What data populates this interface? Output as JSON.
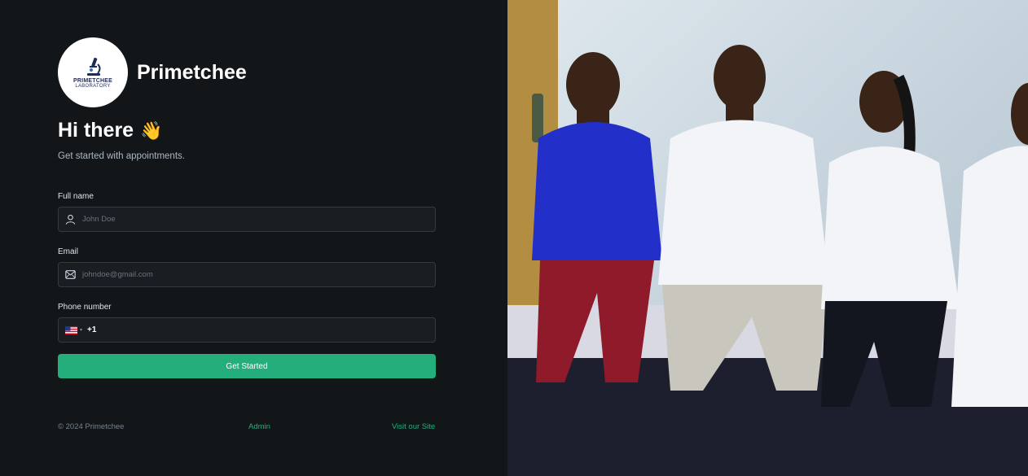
{
  "brand": {
    "name": "Primetchee",
    "logo_title": "PRIMETCHEE",
    "logo_subtitle": "LABORATORY",
    "icon": "microscope-icon"
  },
  "hero": {
    "greeting": "Hi there",
    "wave": "👋",
    "subtitle": "Get started with appointments."
  },
  "form": {
    "full_name": {
      "label": "Full name",
      "placeholder": "John Doe",
      "icon": "user-icon"
    },
    "email": {
      "label": "Email",
      "placeholder": "johndoe@gmail.com",
      "icon": "mail-icon"
    },
    "phone": {
      "label": "Phone number",
      "country_code": "+1",
      "flag": "us-flag-icon",
      "caret": "▾"
    },
    "submit_label": "Get Started"
  },
  "footer": {
    "copyright": "© 2024 Primetchee",
    "admin_link": "Admin",
    "visit_link": "Visit our Site"
  },
  "colors": {
    "background": "#131619",
    "input_background": "#1a1d21",
    "accent": "#24ae7c",
    "muted_text": "#76828d"
  },
  "photo": {
    "subject": "team-photo"
  }
}
